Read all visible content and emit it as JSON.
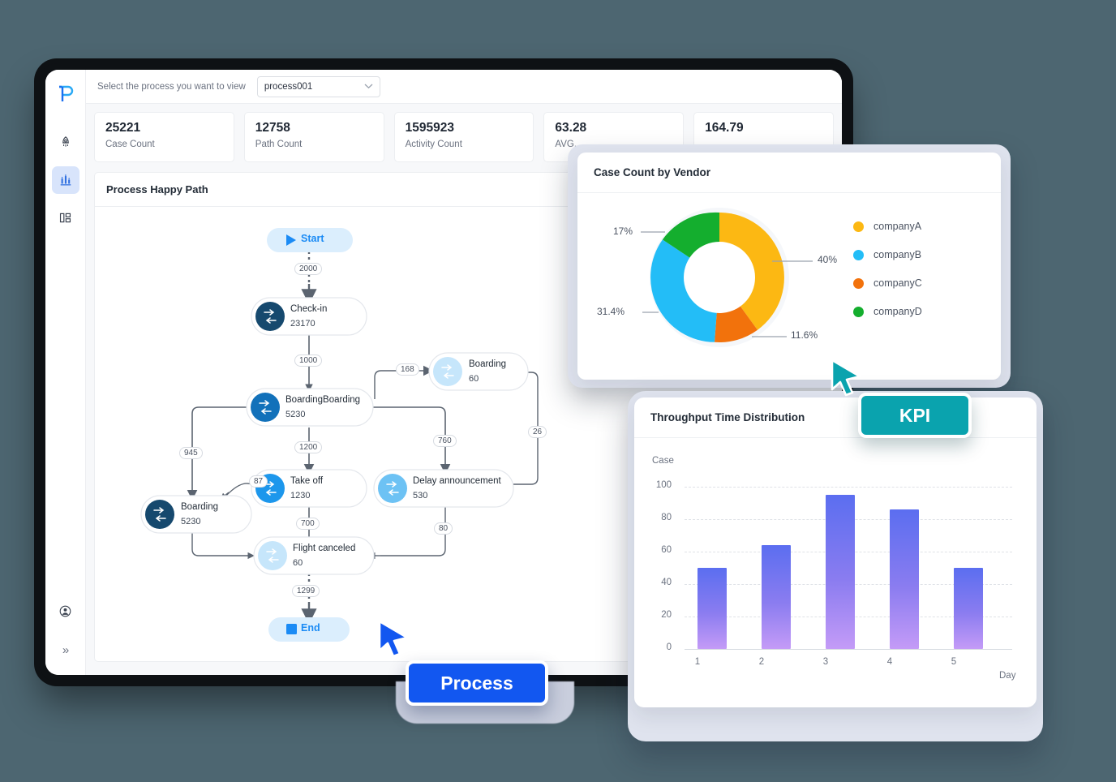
{
  "background_color": "#4d6671",
  "app": {
    "logo_icon": "p-logo-icon",
    "sidebar": {
      "items": [
        {
          "icon": "rocket-icon",
          "name": "rocket",
          "active": false
        },
        {
          "icon": "bar-chart-icon",
          "name": "analytics",
          "active": true
        },
        {
          "icon": "dashboard-grid-icon",
          "name": "dashboard",
          "active": false
        }
      ],
      "bottom": [
        {
          "icon": "user-account-icon",
          "name": "account"
        },
        {
          "icon": "chevron-double-right-icon",
          "name": "expand-sidebar",
          "glyph": "»"
        }
      ]
    },
    "topbar": {
      "label": "Select the process you want to view",
      "select_value": "process001",
      "select_caret": "⌄"
    },
    "kpis": [
      {
        "value": "25221",
        "label": "Case Count"
      },
      {
        "value": "12758",
        "label": "Path Count"
      },
      {
        "value": "1595923",
        "label": "Activity Count"
      },
      {
        "value": "63.28",
        "label": "AVG."
      },
      {
        "value": "164.79",
        "label": ""
      }
    ],
    "process_panel": {
      "title": "Process Happy Path",
      "start_label": "Start",
      "end_label": "End",
      "nodes": [
        {
          "id": "checkin",
          "label": "Check-in",
          "count": "23170",
          "tone": "dark"
        },
        {
          "id": "boarding1",
          "label": "Boarding",
          "count": "60",
          "tone": "pale"
        },
        {
          "id": "bb",
          "label": "BoardingBoarding",
          "count": "5230",
          "tone": "mid"
        },
        {
          "id": "takeoff",
          "label": "Take off",
          "count": "1230",
          "tone": "bright"
        },
        {
          "id": "delay",
          "label": "Delay announcement",
          "count": "530",
          "tone": "light"
        },
        {
          "id": "boarding2",
          "label": "Boarding",
          "count": "5230",
          "tone": "dark2"
        },
        {
          "id": "cancel",
          "label": "Flight canceled",
          "count": "60",
          "tone": "pale"
        }
      ],
      "edge_labels": [
        "2000",
        "1000",
        "168",
        "945",
        "1200",
        "760",
        "26",
        "87",
        "700",
        "80",
        "1299"
      ]
    }
  },
  "donut_card": {
    "title": "Case Count by Vendor"
  },
  "bar_card": {
    "title": "Throughput Time Distribution"
  },
  "badges": {
    "process": "Process",
    "kpi": "KPI"
  },
  "chart_data": [
    {
      "type": "pie",
      "title": "Case Count by Vendor",
      "legend_position": "right",
      "labels": [
        "companyA",
        "companyB",
        "companyC",
        "companyD"
      ],
      "values": [
        40,
        31.4,
        11.6,
        17
      ],
      "value_labels": [
        "40%",
        "31.4%",
        "11.6%",
        "17%"
      ],
      "colors": [
        "#fcb813",
        "#23bdf7",
        "#f2720c",
        "#14ae2e"
      ],
      "donut": true
    },
    {
      "type": "bar",
      "title": "Throughput Time Distribution",
      "categories": [
        "1",
        "2",
        "3",
        "4",
        "5"
      ],
      "values": [
        50,
        64,
        95,
        86,
        50
      ],
      "xlabel": "Day",
      "ylabel": "Case",
      "ylim": [
        0,
        100
      ],
      "yticks": [
        "0",
        "20",
        "40",
        "60",
        "80",
        "100"
      ],
      "grid": true,
      "bar_gradient": [
        "#5b6ef0",
        "#c49bf7"
      ]
    }
  ]
}
